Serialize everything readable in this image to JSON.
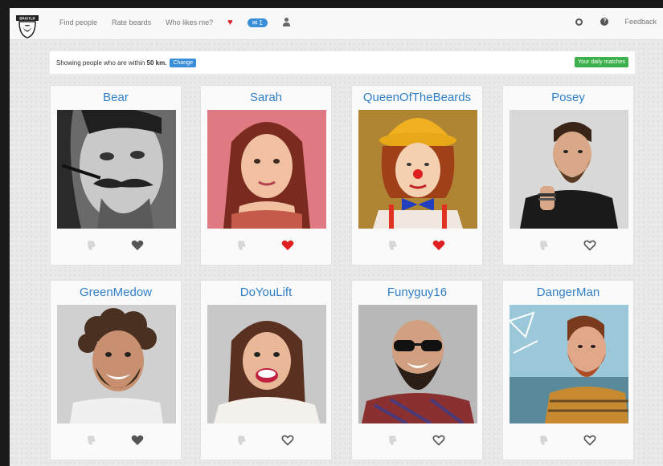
{
  "nav": {
    "logo_text": "BRISTLR",
    "links": [
      "Find people",
      "Rate beards",
      "Who likes me?"
    ],
    "badge_count": "1",
    "feedback": "Feedback"
  },
  "infobar": {
    "text_before": "Showing people who are within",
    "distance": "50 km.",
    "change_label": "Change",
    "daily_label": "Your daily matches"
  },
  "colors": {
    "link_blue": "#2f7fc8",
    "heart_red": "#e02020",
    "button_blue": "#3b8fd9",
    "button_green": "#3cb04a"
  },
  "profiles": [
    {
      "name": "Bear",
      "liked": false,
      "photo": "bw-mustache-man"
    },
    {
      "name": "Sarah",
      "liked": true,
      "photo": "woman-red-hair"
    },
    {
      "name": "QueenOfTheBeards",
      "liked": true,
      "photo": "clown-yellow-hat"
    },
    {
      "name": "Posey",
      "liked": false,
      "photo": "bearded-man-grey"
    },
    {
      "name": "GreenMedow",
      "liked": false,
      "photo": "curly-hair-smiling-man"
    },
    {
      "name": "DoYouLift",
      "liked": false,
      "photo": "smiling-woman"
    },
    {
      "name": "Funyguy16",
      "liked": false,
      "photo": "bald-man-sunglasses"
    },
    {
      "name": "DangerMan",
      "liked": false,
      "photo": "red-beard-outdoor"
    }
  ]
}
